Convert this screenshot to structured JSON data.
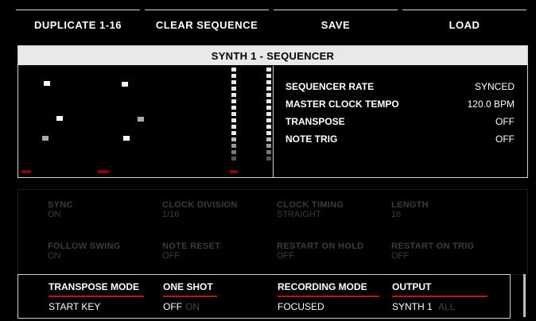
{
  "toolbar": {
    "duplicate": "DUPLICATE 1-16",
    "clear": "CLEAR SEQUENCE",
    "save": "SAVE",
    "load": "LOAD"
  },
  "panel": {
    "title": "SYNTH 1 - SEQUENCER",
    "params": [
      {
        "label": "SEQUENCER RATE",
        "value": "SYNCED"
      },
      {
        "label": "MASTER CLOCK TEMPO",
        "value": "120.0 BPM"
      },
      {
        "label": "TRANSPOSE",
        "value": "OFF"
      },
      {
        "label": "NOTE TRIG",
        "value": "OFF"
      }
    ]
  },
  "faded": {
    "sync": {
      "label": "SYNC",
      "value": "ON"
    },
    "clock_division": {
      "label": "CLOCK DIVISION",
      "value": "1/16"
    },
    "clock_timing": {
      "label": "CLOCK TIMING",
      "value": "STRAIGHT"
    },
    "length": {
      "label": "LENGTH",
      "value": "16"
    },
    "follow_swing": {
      "label": "FOLLOW SWING",
      "value": "ON"
    },
    "note_reset": {
      "label": "NOTE RESET",
      "value": "OFF"
    },
    "restart_on_hold": {
      "label": "RESTART ON HOLD",
      "value": "OFF"
    },
    "restart_on_trig": {
      "label": "RESTART ON TRIG",
      "value": "OFF"
    }
  },
  "bottom": {
    "transpose_mode": {
      "label": "TRANSPOSE MODE",
      "value": "ONE SHOT"
    },
    "recording_mode": {
      "label": "RECORDING MODE",
      "value": "OUTPUT"
    },
    "start_key": {
      "label": "START KEY",
      "off": "OFF",
      "on": "ON"
    },
    "focused": "FOCUSED",
    "synth": "SYNTH 1",
    "synth_alt": "ALL"
  },
  "colors": {
    "accent_red": "#c0121c",
    "background": "#000000",
    "text": "#ffffff"
  }
}
